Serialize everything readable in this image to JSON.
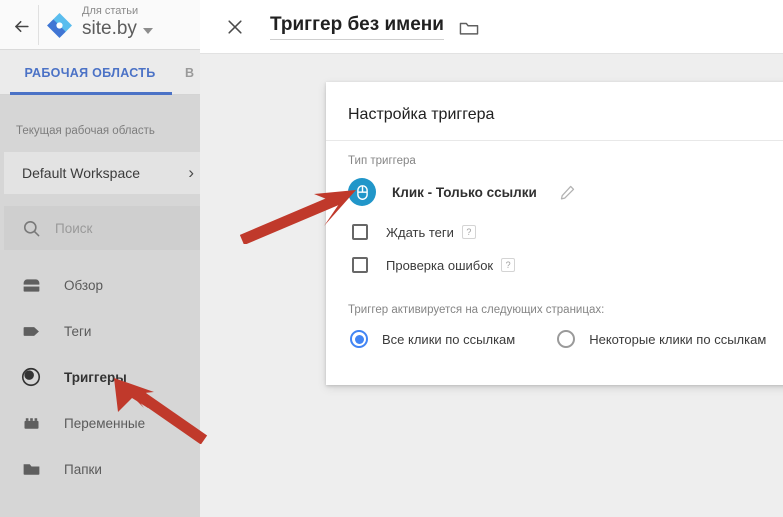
{
  "left_panel": {
    "back_icon": "back-arrow-icon",
    "logo_icon": "gtm-logo-icon",
    "account_kicker": "Для статьи",
    "account_name": "site.by",
    "account_caret_icon": "caret-down-icon",
    "tabs": [
      {
        "label": "РАБОЧАЯ ОБЛАСТЬ",
        "active": true
      },
      {
        "label": "В",
        "active": false
      }
    ],
    "workspace_label": "Текущая рабочая область",
    "workspace_name": "Default Workspace",
    "workspace_chevron_icon": "chevron-right-icon",
    "search": {
      "icon": "search-icon",
      "placeholder": "Поиск",
      "value": ""
    },
    "nav_items": [
      {
        "label": "Обзор",
        "icon": "overview-box-icon",
        "active": false
      },
      {
        "label": "Теги",
        "icon": "tag-icon",
        "active": false
      },
      {
        "label": "Триггеры",
        "icon": "trigger-icon",
        "active": true
      },
      {
        "label": "Переменные",
        "icon": "variables-icon",
        "active": false
      },
      {
        "label": "Папки",
        "icon": "folder-icon",
        "active": false
      }
    ]
  },
  "dialog": {
    "close_icon": "close-icon",
    "title": "Триггер без имени",
    "folder_icon": "folder-move-icon",
    "card": {
      "title": "Настройка триггера",
      "type_label": "Тип триггера",
      "type_icon": "mouse-click-icon",
      "type_name": "Клик - Только ссылки",
      "edit_icon": "pencil-edit-icon",
      "checkboxes": [
        {
          "label": "Ждать теги",
          "checked": false,
          "help": "?"
        },
        {
          "label": "Проверка ошибок",
          "checked": false,
          "help": "?"
        }
      ],
      "fires_label": "Триггер активируется на следующих страницах:",
      "radios": [
        {
          "label": "Все клики по ссылкам",
          "selected": true
        },
        {
          "label": "Некоторые клики по ссылкам",
          "selected": false
        }
      ]
    }
  },
  "annotations": {
    "arrow_color": "#c0392b",
    "arrows": [
      {
        "name": "arrow-pointing-to-trigger-type"
      },
      {
        "name": "arrow-pointing-to-triggers-nav"
      }
    ]
  },
  "colors": {
    "accent_blue": "#4285f4",
    "tab_blue": "#4b72c6",
    "mouse_icon_blue": "#2196c9",
    "sidebar_bg": "#d6d6d6",
    "dialog_bg": "#eeeeee",
    "arrow_red": "#c0392b"
  }
}
